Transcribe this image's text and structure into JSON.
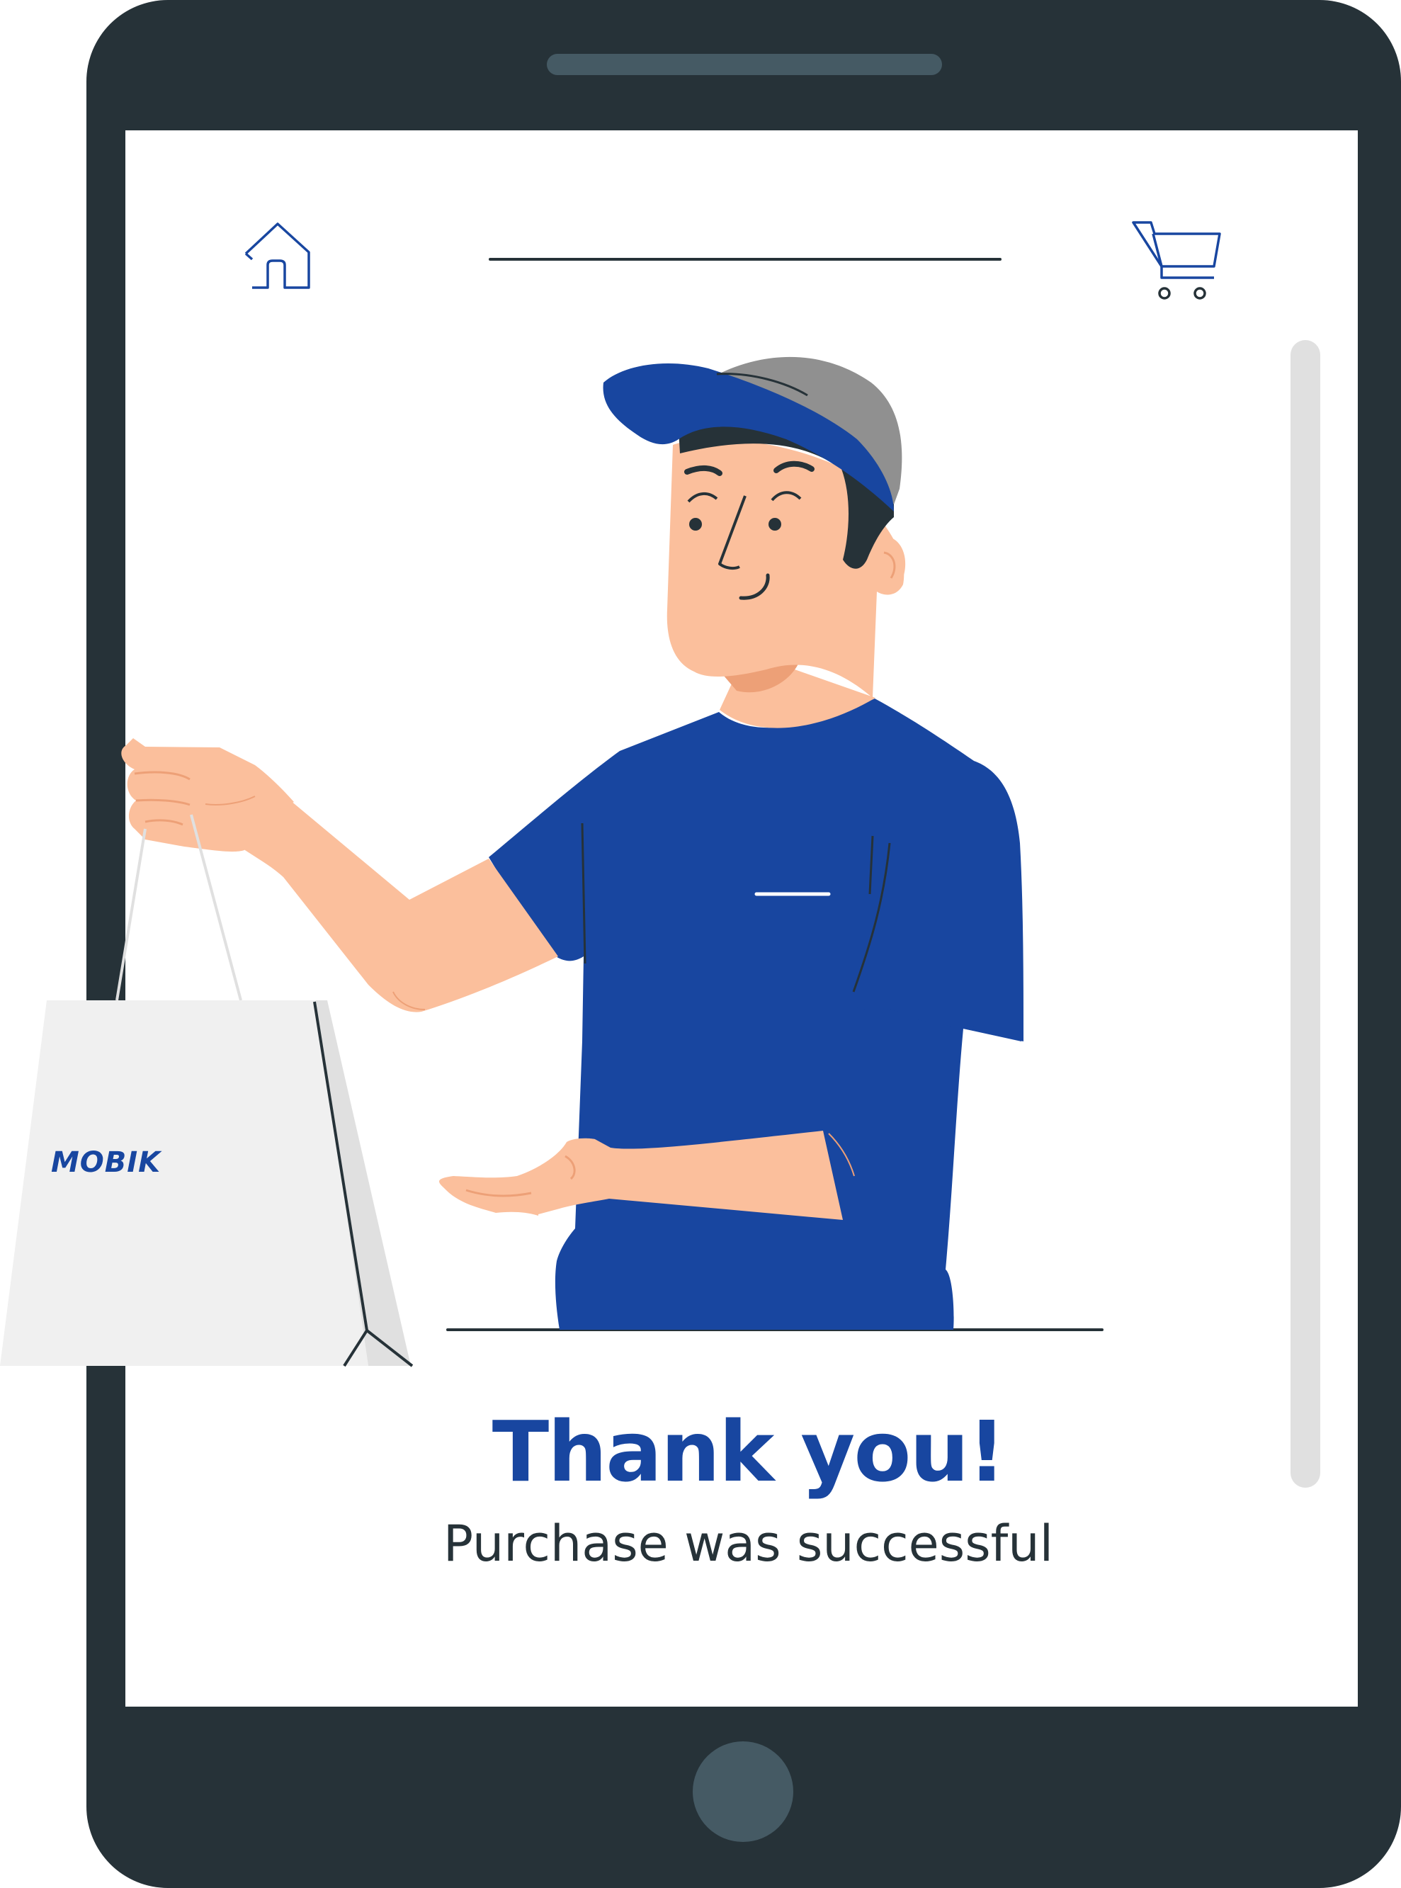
{
  "device": {
    "frame_color": "#263238",
    "accent_color": "#455a64",
    "screen_color": "#ffffff"
  },
  "nav": {
    "home_icon": "home-icon",
    "cart_icon": "cart-icon"
  },
  "illustration": {
    "subject": "delivery-person-handing-bag",
    "bag_brand": "MOBIK",
    "shirt_color": "#1846a0",
    "cap_color": "#1846a0",
    "skin_color": "#fbbf9c"
  },
  "message": {
    "title": "Thank you!",
    "subtitle": "Purchase was successful",
    "title_color": "#1846a0",
    "subtitle_color": "#263238"
  }
}
